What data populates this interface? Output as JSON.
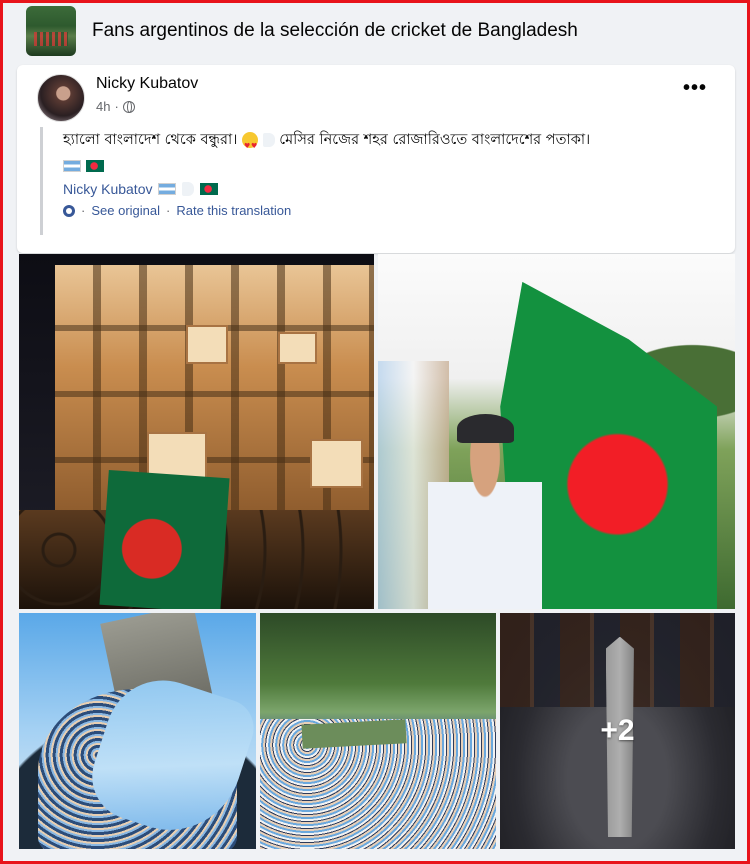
{
  "group": {
    "title": "Fans argentinos de la selección de cricket de Bangladesh"
  },
  "post": {
    "author": "Nicky Kubatov",
    "time": "4h",
    "more_label": "•••",
    "original_text": "হ্যালো বাংলাদেশ থেকে বন্ধুরা।",
    "original_text_2": "মেসির নিজের শহর রোজারিওতে বাংলাদেশের পতাকা।",
    "signature": "Nicky Kubatov",
    "see_original": "See original",
    "rate_translation": "Rate this translation",
    "separator": "·"
  },
  "photos": {
    "more_count": "+2"
  },
  "colors": {
    "frame": "#e8141b",
    "link": "#385898",
    "meta": "#65676b"
  }
}
